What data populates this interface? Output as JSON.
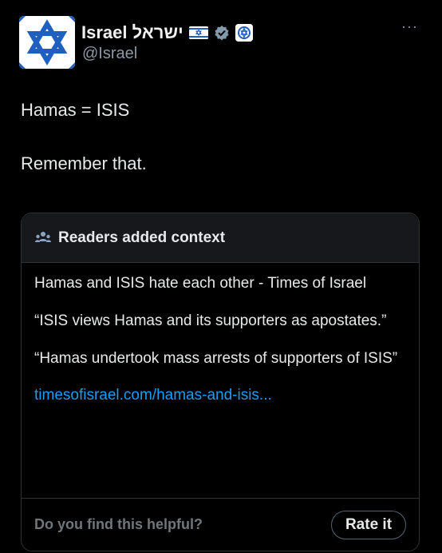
{
  "author": {
    "display_name": "Israel ישראל",
    "handle": "@Israel",
    "avatar_icon": "star-of-david-icon",
    "flag_icon": "israel-flag-icon",
    "verified_icon": "verified-badge-icon",
    "affiliate_icon": "government-affiliate-badge-icon"
  },
  "more_label": "···",
  "tweet": {
    "line1": "Hamas = ISIS",
    "line2": "Remember that."
  },
  "community_note": {
    "header_icon": "people-icon",
    "title": "Readers added context",
    "paragraphs": [
      "Hamas and ISIS hate each other - Times of Israel",
      "“ISIS views Hamas and its supporters as apostates.”",
      "“Hamas undertook mass arrests of supporters of ISIS”"
    ],
    "link": "timesofisrael.com/hamas-and-isis...",
    "question": "Do you find this helpful?",
    "rate_button": "Rate it"
  },
  "colors": {
    "background": "#000000",
    "link": "#1d9bf0",
    "avatar_blue": "#1f5fbf",
    "muted": "#71767b"
  }
}
